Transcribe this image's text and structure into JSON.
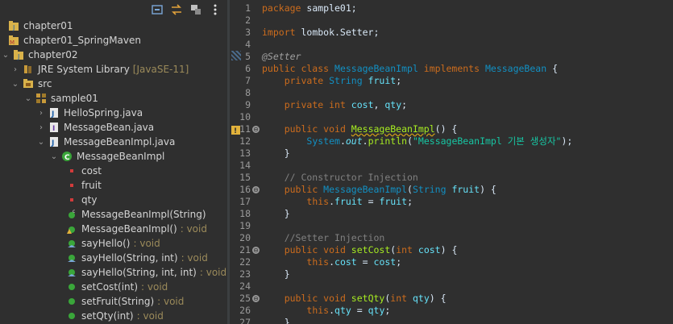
{
  "explorer": {
    "toolbar": [
      "collapse-all-icon",
      "link-with-editor-icon",
      "filter-icon",
      "view-menu-icon"
    ],
    "items": [
      {
        "label": "chapter01",
        "suffix": "",
        "icon": "project-icon",
        "arrow": ""
      },
      {
        "label": "chapter01_SpringMaven",
        "suffix": "",
        "icon": "maven-project-icon",
        "arrow": ""
      },
      {
        "label": "chapter02",
        "suffix": "",
        "icon": "project-icon",
        "arrow": "expanded"
      },
      {
        "label": "JRE System Library",
        "suffix": "[JavaSE-11]",
        "icon": "library-icon",
        "arrow": "collapsed"
      },
      {
        "label": "src",
        "suffix": "",
        "icon": "source-folder-icon",
        "arrow": "expanded"
      },
      {
        "label": "sample01",
        "suffix": "",
        "icon": "package-icon",
        "arrow": "expanded"
      },
      {
        "label": "HelloSpring.java",
        "suffix": "",
        "icon": "java-file-icon",
        "arrow": "collapsed"
      },
      {
        "label": "MessageBean.java",
        "suffix": "",
        "icon": "java-interface-file-icon",
        "arrow": "collapsed"
      },
      {
        "label": "MessageBeanImpl.java",
        "suffix": "",
        "icon": "java-file-icon",
        "arrow": "expanded"
      },
      {
        "label": "MessageBeanImpl",
        "suffix": "",
        "icon": "class-icon",
        "arrow": "expanded"
      },
      {
        "label": "cost",
        "suffix": "",
        "icon": "private-field-icon",
        "arrow": ""
      },
      {
        "label": "fruit",
        "suffix": "",
        "icon": "private-field-icon",
        "arrow": ""
      },
      {
        "label": "qty",
        "suffix": "",
        "icon": "private-field-icon",
        "arrow": ""
      },
      {
        "label": "MessageBeanImpl(String)",
        "suffix": "",
        "icon": "constructor-icon",
        "arrow": ""
      },
      {
        "label": "MessageBeanImpl()",
        "suffix": ": void",
        "icon": "method-warning-icon",
        "arrow": ""
      },
      {
        "label": "sayHello()",
        "suffix": ": void",
        "icon": "override-method-icon",
        "arrow": ""
      },
      {
        "label": "sayHello(String, int)",
        "suffix": ": void",
        "icon": "override-method-icon",
        "arrow": ""
      },
      {
        "label": "sayHello(String, int, int)",
        "suffix": ": void",
        "icon": "override-method-icon",
        "arrow": ""
      },
      {
        "label": "setCost(int)",
        "suffix": ": void",
        "icon": "public-method-icon",
        "arrow": ""
      },
      {
        "label": "setFruit(String)",
        "suffix": ": void",
        "icon": "public-method-icon",
        "arrow": ""
      },
      {
        "label": "setQty(int)",
        "suffix": ": void",
        "icon": "public-method-icon",
        "arrow": ""
      }
    ]
  },
  "editor": {
    "lines": [
      {
        "n": "1",
        "fold": "",
        "html": [
          [
            "kw",
            "package"
          ],
          [
            "",
            " sample01;"
          ]
        ]
      },
      {
        "n": "2",
        "fold": "",
        "html": []
      },
      {
        "n": "3",
        "fold": "",
        "html": [
          [
            "kw",
            "import"
          ],
          [
            "",
            " lombok.Setter;"
          ]
        ]
      },
      {
        "n": "4",
        "fold": "",
        "html": []
      },
      {
        "n": "5",
        "fold": "",
        "html": [
          [
            "anno",
            "@Setter"
          ]
        ]
      },
      {
        "n": "6",
        "fold": "",
        "html": [
          [
            "kw",
            "public class "
          ],
          [
            "type",
            "MessageBeanImpl"
          ],
          [
            "kw",
            " implements "
          ],
          [
            "type",
            "MessageBean"
          ],
          [
            "",
            " {"
          ]
        ]
      },
      {
        "n": "7",
        "fold": "",
        "html": [
          [
            "",
            "    "
          ],
          [
            "kw",
            "private "
          ],
          [
            "type",
            "String "
          ],
          [
            "field",
            "fruit"
          ],
          [
            "",
            ";"
          ]
        ]
      },
      {
        "n": "8",
        "fold": "",
        "html": []
      },
      {
        "n": "9",
        "fold": "",
        "html": [
          [
            "",
            "    "
          ],
          [
            "kw",
            "private int "
          ],
          [
            "field",
            "cost"
          ],
          [
            "",
            ", "
          ],
          [
            "field",
            "qty"
          ],
          [
            "",
            ";"
          ]
        ]
      },
      {
        "n": "10",
        "fold": "",
        "html": []
      },
      {
        "n": "11",
        "fold": "⊖",
        "html": [
          [
            "",
            "    "
          ],
          [
            "kw",
            "public void "
          ],
          [
            "method squiggle",
            "MessageBeanImpl"
          ],
          [
            "",
            "() {"
          ]
        ]
      },
      {
        "n": "12",
        "fold": "",
        "html": [
          [
            "",
            "        "
          ],
          [
            "type",
            "System"
          ],
          [
            "",
            "."
          ],
          [
            "ital",
            "out"
          ],
          [
            "",
            "."
          ],
          [
            "method",
            "println"
          ],
          [
            "",
            "("
          ],
          [
            "str",
            "\"MessageBeanImpl 기본 생성자\""
          ],
          [
            "",
            ");"
          ]
        ]
      },
      {
        "n": "13",
        "fold": "",
        "html": [
          [
            "",
            "    }"
          ]
        ]
      },
      {
        "n": "14",
        "fold": "",
        "html": []
      },
      {
        "n": "15",
        "fold": "",
        "html": [
          [
            "cmt",
            "    // Constructor Injection"
          ]
        ]
      },
      {
        "n": "16",
        "fold": "⊖",
        "html": [
          [
            "",
            "    "
          ],
          [
            "kw",
            "public "
          ],
          [
            "type",
            "MessageBeanImpl"
          ],
          [
            "",
            "("
          ],
          [
            "type",
            "String "
          ],
          [
            "field",
            "fruit"
          ],
          [
            "",
            ") {"
          ]
        ]
      },
      {
        "n": "17",
        "fold": "",
        "html": [
          [
            "",
            "        "
          ],
          [
            "kw",
            "this"
          ],
          [
            "",
            "."
          ],
          [
            "field",
            "fruit"
          ],
          [
            "",
            " = "
          ],
          [
            "field",
            "fruit"
          ],
          [
            "",
            ";"
          ]
        ]
      },
      {
        "n": "18",
        "fold": "",
        "html": [
          [
            "",
            "    }"
          ]
        ]
      },
      {
        "n": "19",
        "fold": "",
        "html": []
      },
      {
        "n": "20",
        "fold": "",
        "html": [
          [
            "cmt",
            "    //Setter Injection"
          ]
        ]
      },
      {
        "n": "21",
        "fold": "⊖",
        "html": [
          [
            "",
            "    "
          ],
          [
            "kw",
            "public void "
          ],
          [
            "method",
            "setCost"
          ],
          [
            "",
            "("
          ],
          [
            "kw",
            "int "
          ],
          [
            "field",
            "cost"
          ],
          [
            "",
            ") {"
          ]
        ]
      },
      {
        "n": "22",
        "fold": "",
        "html": [
          [
            "",
            "        "
          ],
          [
            "kw",
            "this"
          ],
          [
            "",
            "."
          ],
          [
            "field",
            "cost"
          ],
          [
            "",
            " = "
          ],
          [
            "field",
            "cost"
          ],
          [
            "",
            ";"
          ]
        ]
      },
      {
        "n": "23",
        "fold": "",
        "html": [
          [
            "",
            "    }"
          ]
        ]
      },
      {
        "n": "24",
        "fold": "",
        "html": []
      },
      {
        "n": "25",
        "fold": "⊖",
        "html": [
          [
            "",
            "    "
          ],
          [
            "kw",
            "public void "
          ],
          [
            "method",
            "setQty"
          ],
          [
            "",
            "("
          ],
          [
            "kw",
            "int "
          ],
          [
            "field",
            "qty"
          ],
          [
            "",
            ") {"
          ]
        ]
      },
      {
        "n": "26",
        "fold": "",
        "html": [
          [
            "",
            "        "
          ],
          [
            "kw",
            "this"
          ],
          [
            "",
            "."
          ],
          [
            "field",
            "qty"
          ],
          [
            "",
            " = "
          ],
          [
            "field",
            "qty"
          ],
          [
            "",
            ";"
          ]
        ]
      },
      {
        "n": "27",
        "fold": "",
        "html": [
          [
            "",
            "    }"
          ]
        ]
      }
    ]
  },
  "colors": {
    "background": "#2f2f2f",
    "keyword": "#cc6c1d",
    "type": "#1290c3",
    "field": "#66e1f8",
    "method": "#a7ec21",
    "string": "#17c6a3",
    "comment": "#808080"
  }
}
